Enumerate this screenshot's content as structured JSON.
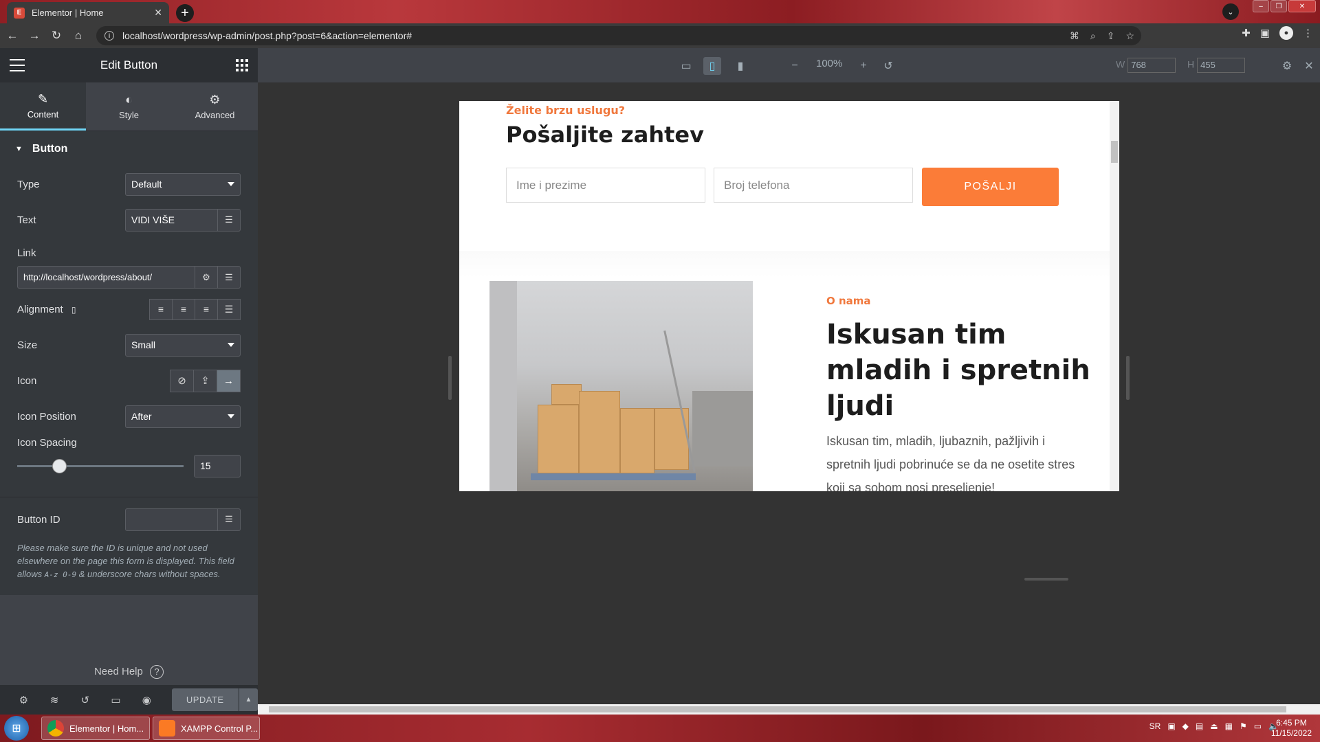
{
  "browser": {
    "tab_title": "Elementor | Home",
    "tab_favicon": "E",
    "url": "localhost/wordpress/wp-admin/post.php?post=6&action=elementor#"
  },
  "panel": {
    "title": "Edit Button",
    "tabs": [
      {
        "label": "Content",
        "icon": "pencil-icon"
      },
      {
        "label": "Style",
        "icon": "contrast-icon"
      },
      {
        "label": "Advanced",
        "icon": "gear-icon"
      }
    ],
    "section_title": "Button",
    "type_label": "Type",
    "type_value": "Default",
    "text_label": "Text",
    "text_value": "VIDI VIŠE",
    "link_label": "Link",
    "link_value": "http://localhost/wordpress/about/",
    "alignment_label": "Alignment",
    "size_label": "Size",
    "size_value": "Small",
    "icon_label": "Icon",
    "icon_position_label": "Icon Position",
    "icon_position_value": "After",
    "icon_spacing_label": "Icon Spacing",
    "icon_spacing_value": "15",
    "icon_spacing_fraction": 0.25,
    "button_id_label": "Button ID",
    "button_id_value": "",
    "note_part1": "Please make sure the ID is unique and not used elsewhere on the page this form is displayed. This field allows ",
    "note_code1": "A-z 0-9",
    "note_part2": " & underscore chars without spaces.",
    "need_help": "Need Help",
    "update_label": "UPDATE"
  },
  "preview_bar": {
    "zoom": "100%",
    "w_label": "W",
    "w_value": "768",
    "h_label": "H",
    "h_value": "455"
  },
  "page": {
    "cta_subtitle": "Želite brzu uslugu?",
    "cta_title": "Pošaljite zahtev",
    "field_name_placeholder": "Ime i prezime",
    "field_phone_placeholder": "Broj telefona",
    "submit_label": "POŠALJI",
    "about_subtitle": "O nama",
    "about_title_line1": "Iskusan tim",
    "about_title_line2": "mladih i spretnih",
    "about_title_line3": "ljudi",
    "about_text": "Iskusan tim, mladih, ljubaznih, pažljivih i spretnih ljudi pobrinuće se da ne osetite stres koji sa sobom nosi preseljenje!"
  },
  "taskbar": {
    "items": [
      {
        "label": "Elementor | Hom..."
      },
      {
        "label": "XAMPP Control P..."
      }
    ],
    "lang": "SR",
    "time": "6:45 PM",
    "date": "11/15/2022"
  },
  "colors": {
    "accent_orange": "#fb7c38",
    "panel_bg": "#404349",
    "active_tab_underline": "#71d7f7"
  }
}
